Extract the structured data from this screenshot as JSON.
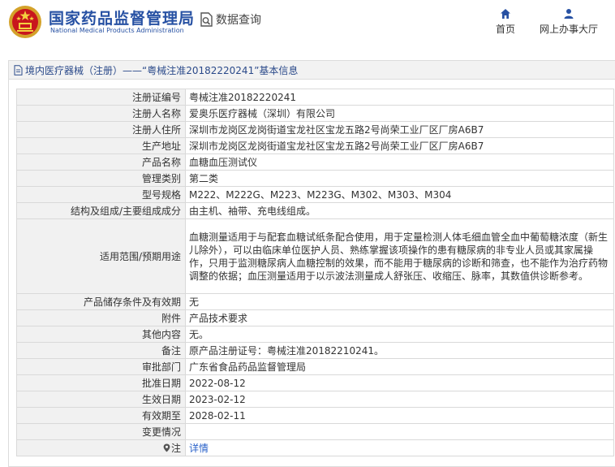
{
  "header": {
    "logo_cn": "国家药品监督管理局",
    "logo_en": "National Medical Products Administration",
    "query_label": "数据查询",
    "nav": {
      "home_label": "首页",
      "hall_label": "网上办事大厅"
    }
  },
  "icons": {
    "emblem": "national-emblem-icon",
    "query": "document-search-icon",
    "home": "home-icon",
    "hall": "user-icon",
    "panel": "document-icon",
    "note": "location-pin-icon"
  },
  "colors": {
    "brand": "#2751a3",
    "link": "#2a62c9",
    "label_bg": "#f1f1f1"
  },
  "panel": {
    "title": "境内医疗器械（注册）——“粤械注准20182220241”基本信息"
  },
  "rows": [
    {
      "label": "注册证编号",
      "value": "粤械注准20182220241"
    },
    {
      "label": "注册人名称",
      "value": "爱奥乐医疗器械（深圳）有限公司"
    },
    {
      "label": "注册人住所",
      "value": "深圳市龙岗区龙岗街道宝龙社区宝龙五路2号尚荣工业厂区厂房A6B7"
    },
    {
      "label": "生产地址",
      "value": "深圳市龙岗区龙岗街道宝龙社区宝龙五路2号尚荣工业厂区厂房A6B7"
    },
    {
      "label": "产品名称",
      "value": "血糖血压测试仪"
    },
    {
      "label": "管理类别",
      "value": "第二类"
    },
    {
      "label": "型号规格",
      "value": "M222、M222G、M223、M223G、M302、M303、M304"
    },
    {
      "label": "结构及组成/主要组成成分",
      "value": "由主机、袖带、充电线组成。"
    },
    {
      "label": "适用范围/预期用途",
      "value": "血糖测量适用于与配套血糖试纸条配合使用，用于定量检测人体毛细血管全血中葡萄糖浓度（新生儿除外），可以由临床单位医护人员、熟练掌握该项操作的患有糖尿病的非专业人员或其家属操作，只用于监测糖尿病人血糖控制的效果，而不能用于糖尿病的诊断和筛查，也不能作为治疗药物调整的依据；血压测量适用于以示波法测量成人舒张压、收缩压、脉率，其数值供诊断参考。"
    },
    {
      "label": "产品储存条件及有效期",
      "value": "无"
    },
    {
      "label": "附件",
      "value": "产品技术要求"
    },
    {
      "label": "其他内容",
      "value": "无。"
    },
    {
      "label": "备注",
      "value": "原产品注册证号：粤械注准20182210241。"
    },
    {
      "label": "审批部门",
      "value": "广东省食品药品监督管理局"
    },
    {
      "label": "批准日期",
      "value": "2022-08-12"
    },
    {
      "label": "生效日期",
      "value": "2023-02-12"
    },
    {
      "label": "有效期至",
      "value": "2028-02-11"
    },
    {
      "label": "变更情况",
      "value": ""
    },
    {
      "label": "注",
      "value": "详情"
    }
  ]
}
